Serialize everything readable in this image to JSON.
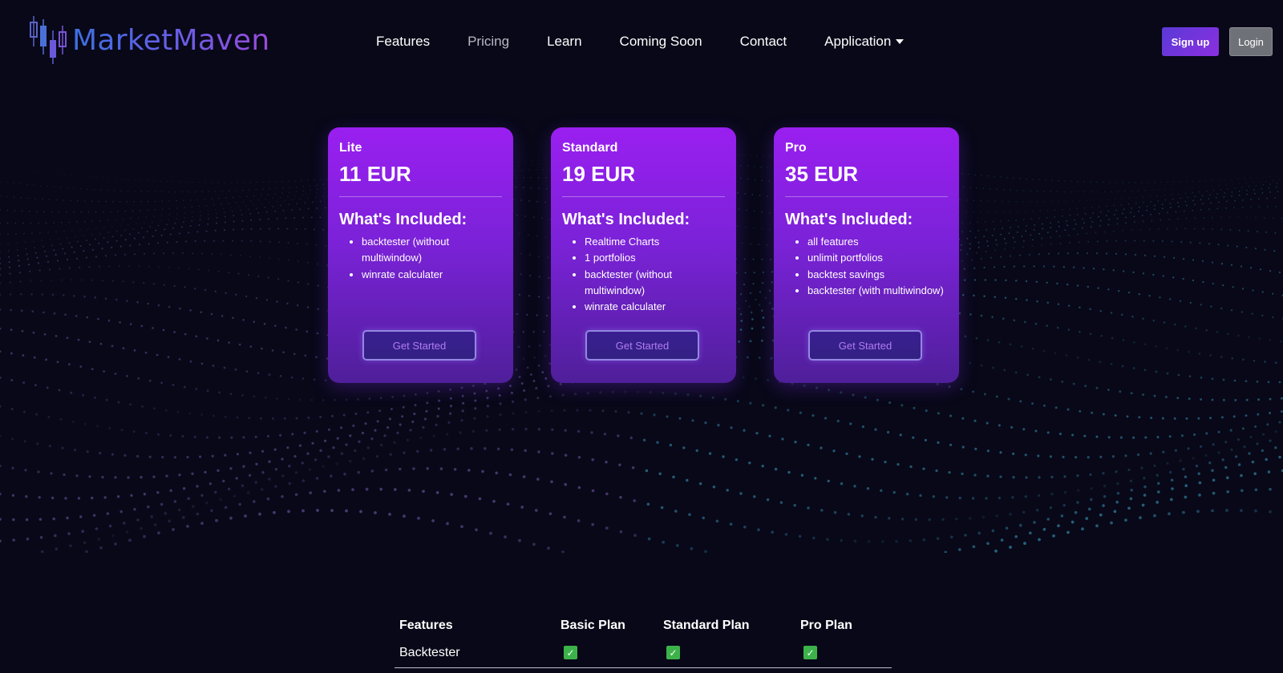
{
  "brand": {
    "name": "MarketMaven"
  },
  "nav": {
    "items": [
      "Features",
      "Pricing",
      "Learn",
      "Coming Soon",
      "Contact",
      "Application"
    ],
    "active": "Pricing"
  },
  "auth": {
    "signup_label": "Sign up",
    "login_label": "Login"
  },
  "plans": [
    {
      "name": "Lite",
      "price": "11 EUR",
      "included_title": "What's Included:",
      "features": [
        "backtester (without multiwindow)",
        "winrate calculater"
      ],
      "button": "Get Started"
    },
    {
      "name": "Standard",
      "price": "19 EUR",
      "included_title": "What's Included:",
      "features": [
        "Realtime Charts",
        "1 portfolios",
        "backtester (without multiwindow)",
        "winrate calculater"
      ],
      "button": "Get Started"
    },
    {
      "name": "Pro",
      "price": "35 EUR",
      "included_title": "What's Included:",
      "features": [
        "all features",
        "unlimit portfolios",
        "backtest savings",
        "backtester (with multiwindow)"
      ],
      "button": "Get Started"
    }
  ],
  "comparison": {
    "headers": [
      "Features",
      "Basic Plan",
      "Standard Plan",
      "Pro Plan"
    ],
    "rows": [
      {
        "feature": "Backtester",
        "basic": true,
        "standard": true,
        "pro": true
      }
    ]
  },
  "colors": {
    "background": "#080818",
    "card_top": "#9a1ff0",
    "card_bottom": "#4f1f9a",
    "signup": "#7a33dc",
    "check": "#3cb34a"
  }
}
